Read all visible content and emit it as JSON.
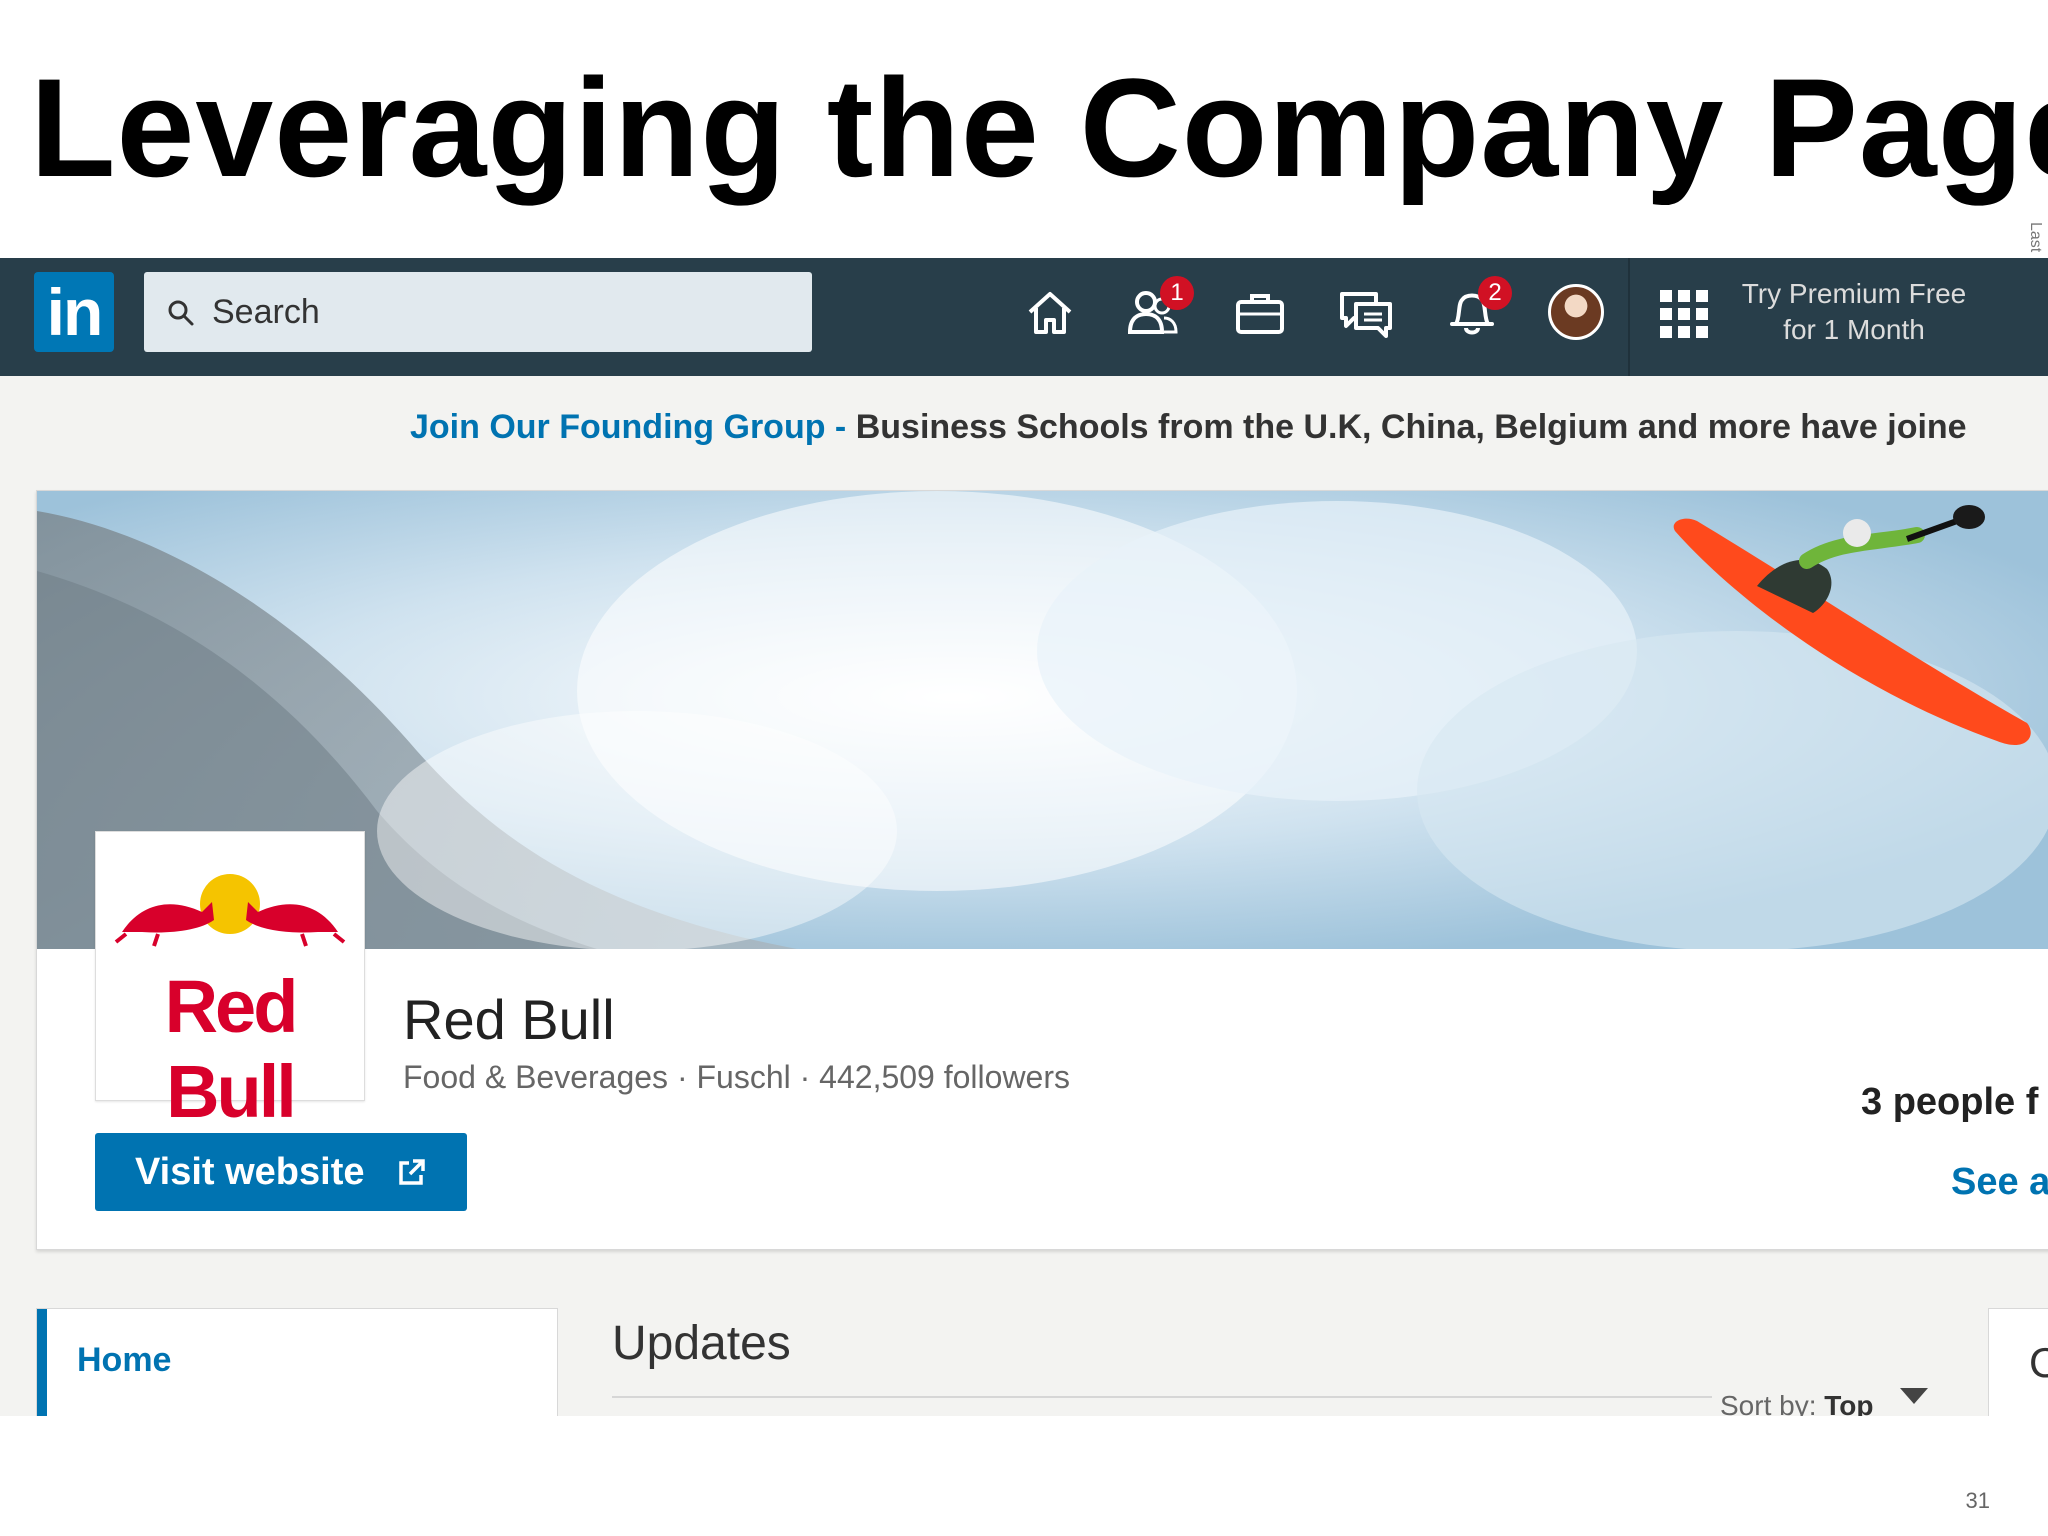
{
  "slide": {
    "title": "Leveraging the Company Page",
    "side_note": "Last",
    "page_number": "31"
  },
  "nav": {
    "logo_text": "in",
    "search_placeholder": "Search",
    "connections_badge": "1",
    "notifications_badge": "2",
    "premium_line1": "Try Premium Free",
    "premium_line2": "for 1 Month"
  },
  "announcement": {
    "link_text": "Join Our Founding Group -",
    "message": " Business Schools from the U.K, China, Belgium and more have joine"
  },
  "company": {
    "logo_text": "Red Bull",
    "name": "Red Bull",
    "meta": "Food & Beverages · Fuschl · 442,509 followers",
    "visit_label": "Visit website",
    "people_text": "3 people f",
    "see_all": "See a"
  },
  "content": {
    "home_tab": "Home",
    "updates_title": "Updates",
    "sort_label": "Sort by:",
    "sort_value": "Top",
    "right_card_char": "C"
  },
  "colors": {
    "nav_bg": "#283e4a",
    "linkedin_blue": "#0073b1",
    "badge_red": "#d11124",
    "redbull_red": "#d8002b"
  },
  "icons": [
    "search-icon",
    "home-icon",
    "my-network-icon",
    "jobs-icon",
    "messaging-icon",
    "notifications-icon",
    "apps-grid-icon",
    "external-link-icon",
    "dropdown-caret-icon"
  ]
}
